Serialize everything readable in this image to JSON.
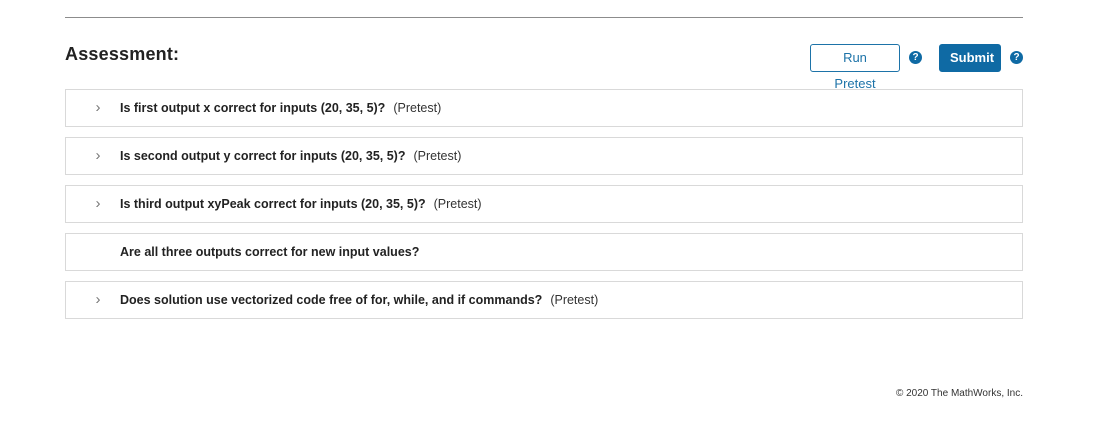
{
  "assessment": {
    "title": "Assessment:",
    "run_pretest_label": "Run Pretest",
    "submit_label": "Submit",
    "help_glyph": "?"
  },
  "tests": [
    {
      "question": "Is first output x correct for inputs (20, 35, 5)?",
      "tag": "(Pretest)",
      "expandable": true
    },
    {
      "question": "Is second output y correct for inputs (20, 35, 5)?",
      "tag": "(Pretest)",
      "expandable": true
    },
    {
      "question": "Is third output xyPeak correct for inputs (20, 35, 5)?",
      "tag": "(Pretest)",
      "expandable": true
    },
    {
      "question": "Are all three outputs correct for new input values?",
      "tag": "",
      "expandable": false
    },
    {
      "question": "Does solution use vectorized code free of for, while, and if commands?",
      "tag": "(Pretest)",
      "expandable": true
    }
  ],
  "icons": {
    "chevron": "chevron-right-icon",
    "help": "help-icon"
  },
  "colors": {
    "accent": "#0f6aa4",
    "border": "#d9d9d9"
  },
  "footer": {
    "copyright": "© 2020 The MathWorks, Inc."
  }
}
